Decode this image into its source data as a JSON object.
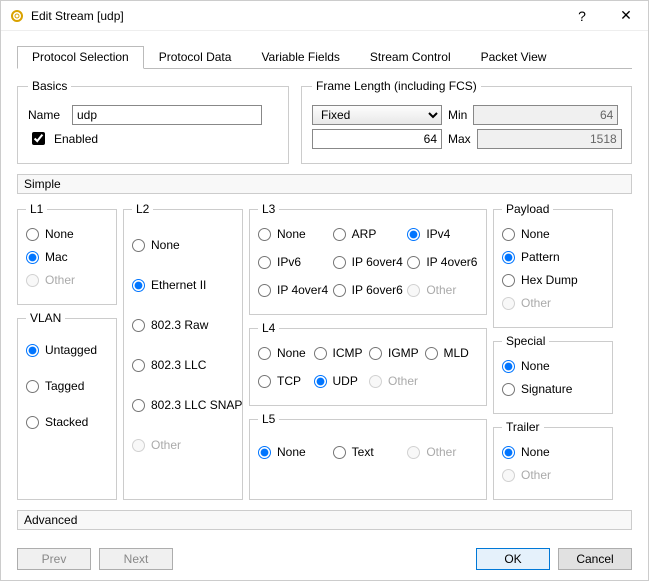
{
  "title": "Edit Stream [udp]",
  "titlebar_buttons": {
    "help": "?",
    "close": "✕"
  },
  "tabs": [
    {
      "label": "Protocol Selection",
      "active": true
    },
    {
      "label": "Protocol Data",
      "active": false
    },
    {
      "label": "Variable Fields",
      "active": false
    },
    {
      "label": "Stream Control",
      "active": false
    },
    {
      "label": "Packet View",
      "active": false
    }
  ],
  "basics": {
    "legend": "Basics",
    "name_label": "Name",
    "name_value": "udp",
    "enabled_label": "Enabled",
    "enabled_checked": true
  },
  "frame_length": {
    "legend": "Frame Length (including FCS)",
    "mode_selected": "Fixed",
    "value": "64",
    "min_label": "Min",
    "max_label": "Max",
    "min_value": "64",
    "max_value": "1518"
  },
  "sections": {
    "simple": "Simple",
    "advanced": "Advanced"
  },
  "l1": {
    "legend": "L1",
    "options": [
      {
        "name": "none",
        "label": "None",
        "selected": false,
        "enabled": true
      },
      {
        "name": "mac",
        "label": "Mac",
        "selected": true,
        "enabled": true
      },
      {
        "name": "other",
        "label": "Other",
        "selected": false,
        "enabled": false
      }
    ]
  },
  "vlan": {
    "legend": "VLAN",
    "options": [
      {
        "name": "untagged",
        "label": "Untagged",
        "selected": true
      },
      {
        "name": "tagged",
        "label": "Tagged",
        "selected": false
      },
      {
        "name": "stacked",
        "label": "Stacked",
        "selected": false
      }
    ]
  },
  "l2": {
    "legend": "L2",
    "options": [
      {
        "name": "none",
        "label": "None",
        "selected": false,
        "enabled": true
      },
      {
        "name": "eth2",
        "label": "Ethernet II",
        "selected": true,
        "enabled": true
      },
      {
        "name": "8023raw",
        "label": "802.3 Raw",
        "selected": false,
        "enabled": true
      },
      {
        "name": "8023llc",
        "label": "802.3 LLC",
        "selected": false,
        "enabled": true
      },
      {
        "name": "8023snap",
        "label": "802.3 LLC SNAP",
        "selected": false,
        "enabled": true
      },
      {
        "name": "other",
        "label": "Other",
        "selected": false,
        "enabled": false
      }
    ]
  },
  "l3": {
    "legend": "L3",
    "options": [
      {
        "name": "none",
        "label": "None",
        "selected": false,
        "enabled": true
      },
      {
        "name": "arp",
        "label": "ARP",
        "selected": false,
        "enabled": true
      },
      {
        "name": "ipv4",
        "label": "IPv4",
        "selected": true,
        "enabled": true
      },
      {
        "name": "ipv6",
        "label": "IPv6",
        "selected": false,
        "enabled": true
      },
      {
        "name": "ip6o4",
        "label": "IP 6over4",
        "selected": false,
        "enabled": true
      },
      {
        "name": "ip4o6",
        "label": "IP 4over6",
        "selected": false,
        "enabled": true
      },
      {
        "name": "ip4o4",
        "label": "IP 4over4",
        "selected": false,
        "enabled": true
      },
      {
        "name": "ip6o6",
        "label": "IP 6over6",
        "selected": false,
        "enabled": true
      },
      {
        "name": "other",
        "label": "Other",
        "selected": false,
        "enabled": false
      }
    ]
  },
  "l4": {
    "legend": "L4",
    "options": [
      {
        "name": "none",
        "label": "None",
        "selected": false,
        "enabled": true
      },
      {
        "name": "icmp",
        "label": "ICMP",
        "selected": false,
        "enabled": true
      },
      {
        "name": "igmp",
        "label": "IGMP",
        "selected": false,
        "enabled": true
      },
      {
        "name": "mld",
        "label": "MLD",
        "selected": false,
        "enabled": true
      },
      {
        "name": "tcp",
        "label": "TCP",
        "selected": false,
        "enabled": true
      },
      {
        "name": "udp",
        "label": "UDP",
        "selected": true,
        "enabled": true
      },
      {
        "name": "other",
        "label": "Other",
        "selected": false,
        "enabled": false
      }
    ]
  },
  "l5": {
    "legend": "L5",
    "options": [
      {
        "name": "none",
        "label": "None",
        "selected": true,
        "enabled": true
      },
      {
        "name": "text",
        "label": "Text",
        "selected": false,
        "enabled": true
      },
      {
        "name": "other",
        "label": "Other",
        "selected": false,
        "enabled": false
      }
    ]
  },
  "payload": {
    "legend": "Payload",
    "options": [
      {
        "name": "none",
        "label": "None",
        "selected": false,
        "enabled": true
      },
      {
        "name": "pattern",
        "label": "Pattern",
        "selected": true,
        "enabled": true
      },
      {
        "name": "hexdump",
        "label": "Hex Dump",
        "selected": false,
        "enabled": true
      },
      {
        "name": "other",
        "label": "Other",
        "selected": false,
        "enabled": false
      }
    ]
  },
  "special": {
    "legend": "Special",
    "options": [
      {
        "name": "none",
        "label": "None",
        "selected": true,
        "enabled": true
      },
      {
        "name": "signature",
        "label": "Signature",
        "selected": false,
        "enabled": true
      }
    ]
  },
  "trailer": {
    "legend": "Trailer",
    "options": [
      {
        "name": "none",
        "label": "None",
        "selected": true,
        "enabled": true
      },
      {
        "name": "other",
        "label": "Other",
        "selected": false,
        "enabled": false
      }
    ]
  },
  "footer": {
    "prev": "Prev",
    "next": "Next",
    "ok": "OK",
    "cancel": "Cancel"
  }
}
